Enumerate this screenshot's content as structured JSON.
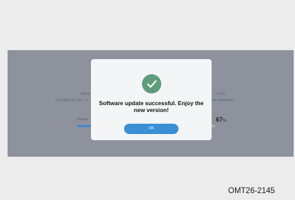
{
  "background_screen": {
    "line1_left": "Vehic",
    "line2_left": "fault light lit, etc., w",
    "line1_right": "r OFF,",
    "line2_right": "form any operation",
    "remaining_label": "Remai",
    "progress_value": "67",
    "progress_unit": "%",
    "progress_fraction": 0.67
  },
  "dialog": {
    "icon": "checkmark-icon",
    "message": "Software update successful. Enjoy the new version!",
    "ok_label": "OK"
  },
  "caption": "OMT26-2145",
  "colors": {
    "overlay": "#8d929c",
    "check_green": "#5e9c7b",
    "button_blue": "#3a8fd6"
  }
}
